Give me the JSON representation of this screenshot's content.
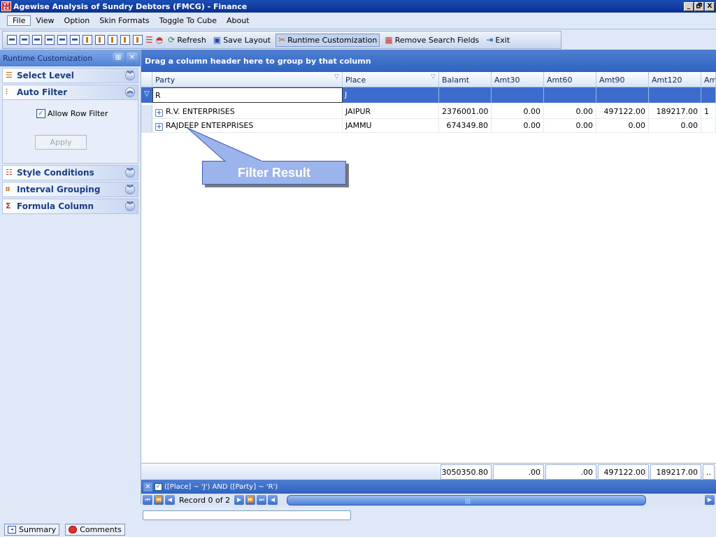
{
  "window": {
    "title": "Agewise Analysis of Sundry Debtors (FMCG) - Finance",
    "app_icon_text": "VT EX",
    "controls": [
      "_",
      "🗗",
      "X"
    ]
  },
  "menu": [
    "File",
    "View",
    "Option",
    "Skin Formats",
    "Toggle To Cube",
    "About"
  ],
  "toolbar": {
    "refresh": "Refresh",
    "save_layout": "Save Layout",
    "runtime_customization": "Runtime Customization",
    "remove_search_fields": "Remove Search Fields",
    "exit": "Exit"
  },
  "left_panel": {
    "title": "Runtime Customization",
    "sections": {
      "select_level": "Select Level",
      "auto_filter": "Auto Filter",
      "style_conditions": "Style Conditions",
      "interval_grouping": "Interval Grouping",
      "formula_column": "Formula Column"
    },
    "allow_row_filter": "Allow Row Filter",
    "apply": "Apply"
  },
  "grid": {
    "group_panel_text": "Drag a column header here to group by that column",
    "columns": [
      "Party",
      "Place",
      "Balamt",
      "Amt30",
      "Amt60",
      "Amt90",
      "Amt120",
      "Am"
    ],
    "filter_values": {
      "party": "R",
      "place": "J"
    },
    "rows": [
      {
        "party": "R.V. ENTERPRISES",
        "place": "JAIPUR",
        "balamt": "2376001.00",
        "amt30": "0.00",
        "amt60": "0.00",
        "amt90": "497122.00",
        "amt120": "189217.00",
        "extra": "1"
      },
      {
        "party": "RAJDEEP ENTERPRISES",
        "place": "JAMMU",
        "balamt": "674349.80",
        "amt30": "0.00",
        "amt60": "0.00",
        "amt90": "0.00",
        "amt120": "0.00",
        "extra": ""
      }
    ],
    "totals": {
      "balamt": "3050350.80",
      "amt30": ".00",
      "amt60": ".00",
      "amt90": "497122.00",
      "amt120": "189217.00",
      "extra": ".."
    },
    "filter_expression": "([Place] ~ 'J') AND ([Party] ~ 'R')",
    "navigator": "Record 0 of 2"
  },
  "callout": {
    "text": "Filter Result"
  },
  "taskbar": {
    "summary": "Summary",
    "comments": "Comments"
  }
}
